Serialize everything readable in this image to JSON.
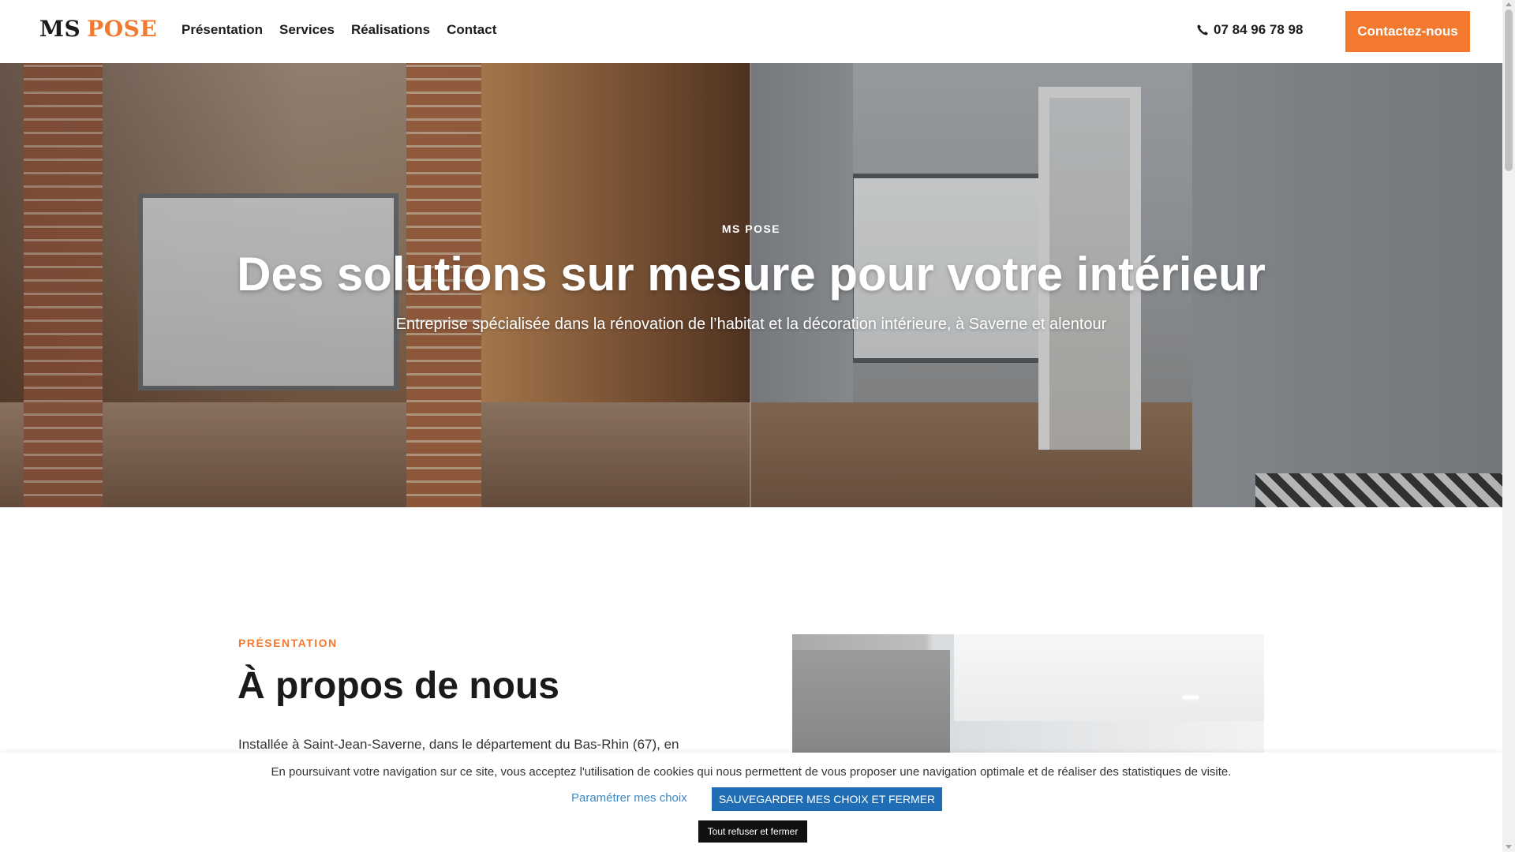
{
  "header": {
    "logo_primary": "MS",
    "logo_accent": "POSE",
    "nav": [
      {
        "label": "Présentation"
      },
      {
        "label": "Services"
      },
      {
        "label": "Réalisations"
      },
      {
        "label": "Contact"
      }
    ],
    "phone_icon": "phone-icon",
    "phone": "07 84 96 78 98",
    "cta_label": "Contactez-nous"
  },
  "hero": {
    "kicker": "MS POSE",
    "title": "Des solutions sur mesure pour votre intérieur",
    "subtitle": "Entreprise spécialisée dans la rénovation de l’habitat et la décoration intérieure, à Saverne et alentour"
  },
  "about": {
    "kicker": "PRÉSENTATION",
    "title": "À propos de nous",
    "text": "Installée à Saint-Jean-Saverne, dans le département du Bas-Rhin (67), en"
  },
  "cookie": {
    "message": "En poursuivant votre navigation sur ce site, vous acceptez l'utilisation de cookies qui nous permettent de vous proposer une navigation optimale et de réaliser des statistiques de visite.",
    "settings_link": "Paramétrer mes choix",
    "save_button": "SAUVEGARDER MES CHOIX ET FERMER",
    "refuse_button": "Tout refuser et fermer"
  },
  "colors": {
    "accent": "#f2792e",
    "cookie_primary": "#1f6db5",
    "cookie_link": "#3a87c8",
    "text_dark": "#1a1a1a"
  }
}
